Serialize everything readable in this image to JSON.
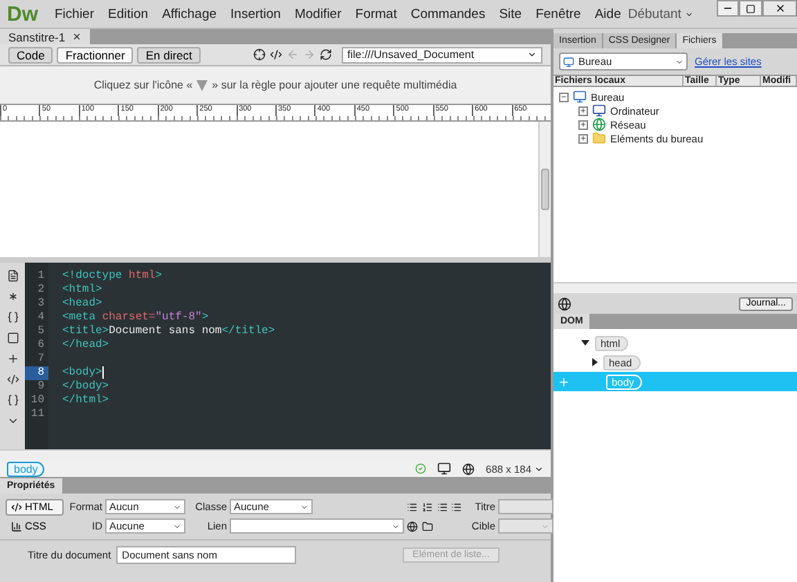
{
  "app": {
    "logo": "Dw",
    "menus": [
      "Fichier",
      "Edition",
      "Affichage",
      "Insertion",
      "Modifier",
      "Format",
      "Commandes",
      "Site",
      "Fenêtre",
      "Aide"
    ],
    "workspace": "Débutant"
  },
  "document": {
    "tab": "Sanstitre-1",
    "view_buttons": [
      {
        "label": "Code",
        "selected": false
      },
      {
        "label": "Fractionner",
        "selected": true
      },
      {
        "label": "En direct",
        "selected": false
      }
    ],
    "address": "file:///Unsaved_Document",
    "hint_before": "Cliquez sur l'icône «",
    "hint_after": "» sur la règle pour ajouter une requête multimédia",
    "ruler": [
      "0",
      "50",
      "100",
      "150",
      "200",
      "250",
      "300",
      "350",
      "400",
      "450",
      "500",
      "550",
      "600",
      "650"
    ]
  },
  "code_lines": [
    {
      "number": "1",
      "current": false,
      "tokens": [
        {
          "kind": "tag",
          "text": "<!doctype "
        },
        {
          "kind": "attr",
          "text": "html"
        },
        {
          "kind": "tag",
          "text": ">"
        }
      ]
    },
    {
      "number": "2",
      "current": false,
      "tokens": [
        {
          "kind": "tag",
          "text": "<html>"
        }
      ]
    },
    {
      "number": "3",
      "current": false,
      "tokens": [
        {
          "kind": "tag",
          "text": "<head>"
        }
      ]
    },
    {
      "number": "4",
      "current": false,
      "tokens": [
        {
          "kind": "tag",
          "text": "<meta "
        },
        {
          "kind": "attr",
          "text": "charset="
        },
        {
          "kind": "string",
          "text": "\"utf-8\""
        },
        {
          "kind": "tag",
          "text": ">"
        }
      ]
    },
    {
      "number": "5",
      "current": false,
      "tokens": [
        {
          "kind": "tag",
          "text": "<title>"
        },
        {
          "kind": "text",
          "text": "Document sans nom"
        },
        {
          "kind": "tag",
          "text": "</title>"
        }
      ]
    },
    {
      "number": "6",
      "current": false,
      "tokens": [
        {
          "kind": "tag",
          "text": "</head>"
        }
      ]
    },
    {
      "number": "7",
      "current": false
    },
    {
      "number": "8",
      "current": true,
      "tokens": [
        {
          "kind": "tag",
          "text": "<body>"
        }
      ]
    },
    {
      "number": "9",
      "current": false,
      "tokens": [
        {
          "kind": "tag",
          "text": "</body>"
        }
      ]
    },
    {
      "number": "10",
      "current": false,
      "tokens": [
        {
          "kind": "tag",
          "text": "</html>"
        }
      ]
    },
    {
      "number": "11",
      "current": false
    }
  ],
  "status": {
    "tag": "body",
    "size": "688 x 184"
  },
  "properties": {
    "title": "Propriétés",
    "modes": [
      {
        "label": "HTML",
        "selected": true
      },
      {
        "label": "CSS",
        "selected": false
      }
    ],
    "format_label": "Format",
    "format": "Aucun",
    "id_label": "ID",
    "id": "Aucune",
    "class_label": "Classe",
    "class": "Aucune",
    "link_label": "Lien",
    "title_label": "Titre",
    "target_label": "Cible",
    "doc_title_label": "Titre du document",
    "doc_title": "Document sans nom",
    "list_button": {
      "label": "Elément de liste...",
      "disabled": true
    }
  },
  "files_panel": {
    "tabs": [
      {
        "label": "Insertion",
        "selected": false
      },
      {
        "label": "CSS Designer",
        "selected": false
      },
      {
        "label": "Fichiers",
        "selected": true
      }
    ],
    "site": "Bureau",
    "manage_link": "Gérer les sites",
    "columns": [
      "Fichiers locaux",
      "Taille",
      "Type",
      "Modifi"
    ],
    "tree": [
      {
        "label": "Bureau",
        "kind": "desktop",
        "expanded": true,
        "children": [
          {
            "label": "Ordinateur",
            "kind": "computer",
            "expanded": false
          },
          {
            "label": "Réseau",
            "kind": "network",
            "expanded": false
          },
          {
            "label": "Eléments du bureau",
            "kind": "folder",
            "expanded": false
          }
        ]
      }
    ],
    "journal_button": "Journal..."
  },
  "dom_panel": {
    "tab": "DOM",
    "tree": [
      {
        "label": "html",
        "expanded": true,
        "selected": false,
        "children": [
          {
            "label": "head",
            "expanded": false,
            "selected": false
          },
          {
            "label": "body",
            "selected": true
          }
        ]
      }
    ]
  }
}
